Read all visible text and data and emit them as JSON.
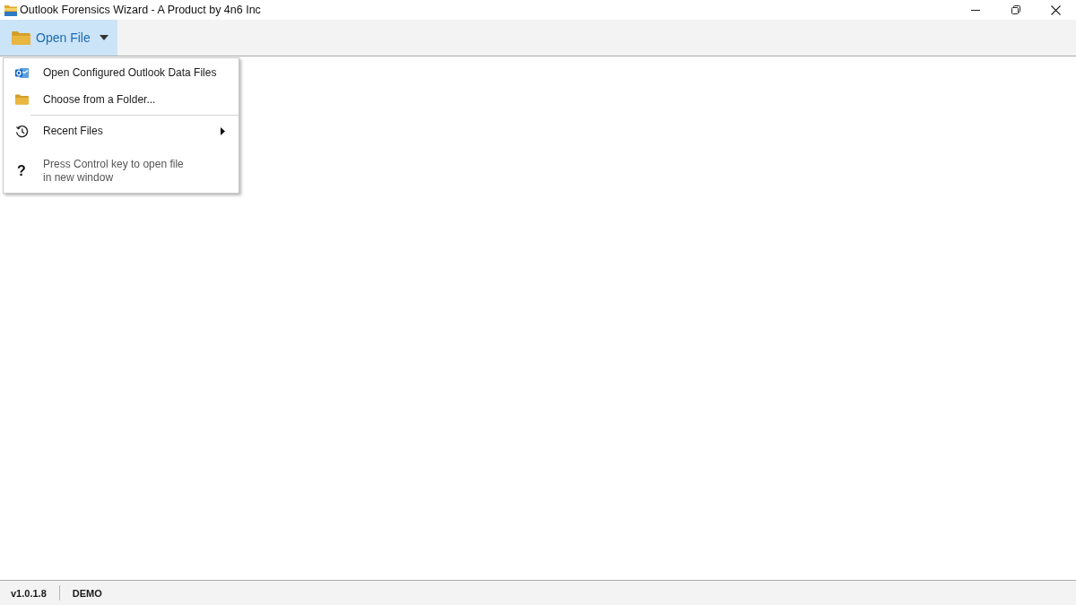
{
  "window": {
    "title": "Outlook Forensics Wizard - A Product by 4n6 Inc"
  },
  "toolbar": {
    "open_file": {
      "label": "Open File",
      "expanded": true
    }
  },
  "menu": {
    "items": [
      {
        "kind": "command",
        "label": "Open Configured Outlook Data Files"
      },
      {
        "kind": "command",
        "label": "Choose from a Folder..."
      },
      {
        "kind": "separator"
      },
      {
        "kind": "submenu",
        "label": "Recent Files"
      },
      {
        "kind": "hint",
        "symbol": "?",
        "label": "Press Control key to open file\nin new window"
      }
    ]
  },
  "status_bar": {
    "items": [
      "v1.0.1.8",
      "DEMO"
    ]
  }
}
